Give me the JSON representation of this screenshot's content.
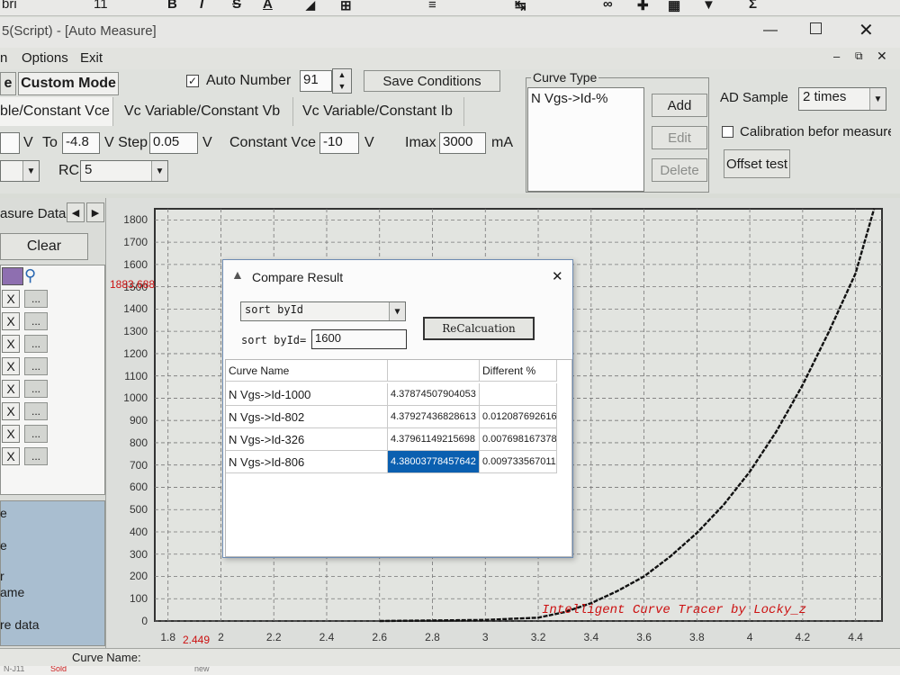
{
  "ribbon": {
    "font_name": "bri",
    "font_size": "11",
    "bold": "B",
    "italic": "I",
    "strike": "S",
    "underline_a": "A"
  },
  "window": {
    "title": "5(Script) - [Auto Measure]"
  },
  "menu": {
    "options": "Options",
    "exit": "Exit",
    "partial": "n"
  },
  "mode": {
    "partial_tab": "e",
    "custom_mode": "Custom Mode"
  },
  "auto_number": {
    "label": "Auto Number",
    "value": "91",
    "checked": true
  },
  "save_conditions": "Save Conditions",
  "tabs": [
    "ble/Constant Vce",
    "Vc Variable/Constant Vb",
    "Vc Variable/Constant Ib"
  ],
  "params": {
    "v_unit": "V",
    "to_label": "To",
    "to_value": "-4.8",
    "vstep_label": "V Step",
    "vstep_value": "0.05",
    "vstep_unit": "V",
    "constvce_label": "Constant Vce",
    "constvce_value": "-10",
    "constvce_unit": "V",
    "imax_label": "Imax",
    "imax_value": "3000",
    "imax_unit": "mA",
    "rc_label": "RC",
    "rc_value": "5"
  },
  "curve_type": {
    "title": "Curve Type",
    "item": "N Vgs->Id-%",
    "add": "Add",
    "edit": "Edit",
    "delete": "Delete"
  },
  "ad_sample": {
    "label": "AD Sample",
    "value": "2 times",
    "calibration": "Calibration befor measure",
    "offset_test": "Offset test"
  },
  "left_panel": {
    "measure_data": "asure Data",
    "clear": "Clear",
    "x_label": "X",
    "dots": "...",
    "labels": [
      "e",
      "e",
      "r",
      "ame",
      "re data"
    ]
  },
  "chart_data": {
    "type": "line",
    "xlabel": "",
    "ylabel": "",
    "x_ticks": [
      "1.8",
      "2",
      "2.2",
      "2.4",
      "2.6",
      "2.8",
      "3",
      "3.2",
      "3.4",
      "3.6",
      "3.8",
      "4",
      "4.2",
      "4.4"
    ],
    "y_ticks": [
      "0",
      "100",
      "200",
      "300",
      "400",
      "500",
      "600",
      "700",
      "800",
      "900",
      "1000",
      "1100",
      "1200",
      "1300",
      "1400",
      "1500",
      "1600",
      "1700",
      "1800"
    ],
    "xlim": [
      1.75,
      4.5
    ],
    "ylim": [
      0,
      1850
    ],
    "grid": true,
    "cursor_y_label": "1883.688",
    "cursor_x_label": "2.449",
    "watermark": "Intelligent Curve Tracer by Locky_z",
    "series": [
      {
        "x": [
          2.6,
          3.0,
          3.2,
          3.3,
          3.4,
          3.5,
          3.6,
          3.7,
          3.8,
          3.9,
          4.0,
          4.1,
          4.2,
          4.3,
          4.4,
          4.47
        ],
        "y": [
          0,
          5,
          15,
          40,
          80,
          135,
          200,
          290,
          395,
          520,
          670,
          850,
          1060,
          1300,
          1560,
          1850
        ]
      }
    ],
    "color": "#111111"
  },
  "dialog": {
    "title": "Compare Result",
    "sort_option": "sort byId",
    "recalc": "ReCalcuation",
    "sort_label": "sort byId=",
    "sort_value": "1600",
    "headers": [
      "Curve Name",
      "",
      "Different %"
    ],
    "rows": [
      [
        "N Vgs->Id-1000",
        "4.37874507904053",
        ""
      ],
      [
        "N Vgs->Id-802",
        "4.37927436828613",
        "0.012087692616"
      ],
      [
        "N Vgs->Id-326",
        "4.37961149215698",
        "0.007698167378"
      ],
      [
        "N Vgs->Id-806",
        "4.38003778457642",
        "0.009733567011"
      ]
    ]
  },
  "status": {
    "curve_name": "Curve Name:",
    "sheet1": "N-J11",
    "sheet2": "Sold",
    "sheet3": "new"
  },
  "colors": {
    "accent_select": "#0a5fb0",
    "watermark_red": "#cc1111"
  }
}
